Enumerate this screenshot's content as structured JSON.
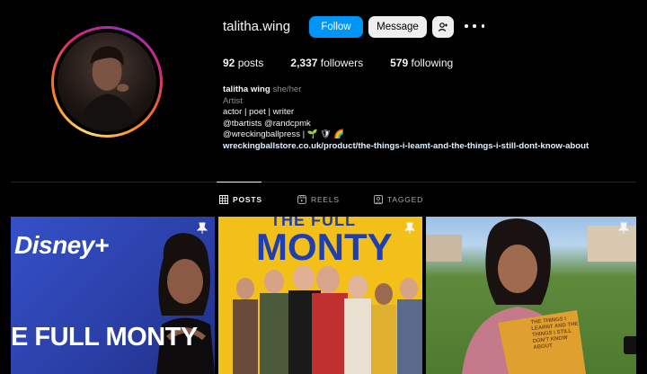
{
  "profile": {
    "username": "talitha.wing",
    "follow_label": "Follow",
    "message_label": "Message",
    "stats": {
      "posts_count": "92",
      "posts_label": "posts",
      "followers_count": "2,337",
      "followers_label": "followers",
      "following_count": "579",
      "following_label": "following"
    },
    "bio": {
      "name": "talitha wing",
      "pronouns": "she/her",
      "category": "Artist",
      "line1": "actor | poet | writer",
      "line2": "@tbartists @randcpmk",
      "line3": "@wreckingballpress | 🌱 🛡 🌈",
      "link": "wreckingballstore.co.uk/product/the-things-i-leamt-and-the-things-i-still-dont-know-about"
    }
  },
  "tabs": [
    {
      "label": "POSTS",
      "icon": "grid-icon",
      "active": true
    },
    {
      "label": "REELS",
      "icon": "reels-icon",
      "active": false
    },
    {
      "label": "TAGGED",
      "icon": "tagged-icon",
      "active": false
    }
  ],
  "posts": [
    {
      "brand": "Disney+",
      "title": "E FULL MONTY",
      "icon": "pin-icon"
    },
    {
      "title_top": "THE FULL",
      "title_main": "MONTY",
      "icon": "pin-icon"
    },
    {
      "book_text": "THE THINGS I LEARNT AND THE THINGS I STILL DON'T KNOW ABOUT",
      "icon": "pin-icon"
    }
  ],
  "colors": {
    "follow_button": "#0095f6",
    "message_button": "#efefef",
    "background": "#000000"
  }
}
